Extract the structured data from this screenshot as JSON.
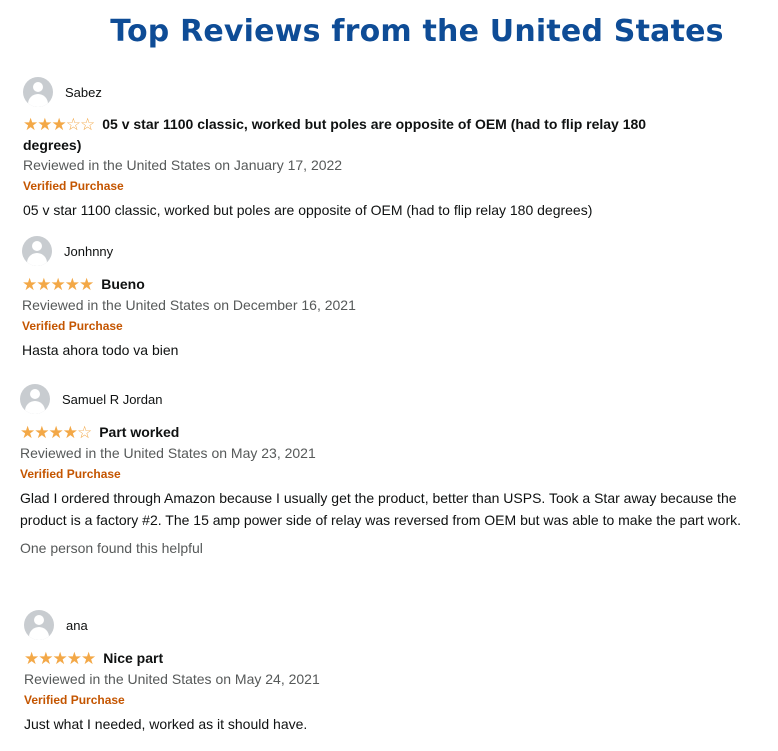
{
  "page": {
    "heading": "Top Reviews from the United States"
  },
  "reviews": [
    {
      "reviewer": "Sabez",
      "rating_stars_filled": 3,
      "rating_stars_total": 5,
      "title": "05 v star 1100 classic, worked but poles are opposite of OEM (had to flip relay 180 degrees)",
      "date": "Reviewed in the United States on January 17, 2022",
      "verified": "Verified Purchase",
      "body": "05 v star 1100 classic, worked but poles are opposite of OEM (had to flip relay 180 degrees)"
    },
    {
      "reviewer": "Jonhnny",
      "rating_stars_filled": 5,
      "rating_stars_total": 5,
      "title": "Bueno",
      "date": "Reviewed in the United States on December 16, 2021",
      "verified": "Verified Purchase",
      "body": "Hasta ahora todo va bien"
    },
    {
      "reviewer": "Samuel R Jordan",
      "rating_stars_filled": 4,
      "rating_stars_total": 5,
      "title": "Part worked",
      "date": "Reviewed in the United States on May 23, 2021",
      "verified": "Verified Purchase",
      "body": "Glad I ordered through Amazon because I usually get the product, better than USPS. Took a Star away because the product is a factory #2. The 15 amp power side of relay was reversed from OEM but was able to make the part work.",
      "helpful": "One person found this helpful"
    },
    {
      "reviewer": "ana",
      "rating_stars_filled": 5,
      "rating_stars_total": 5,
      "title": "Nice part",
      "date": "Reviewed in the United States on May 24, 2021",
      "verified": "Verified Purchase",
      "body": "Just what I needed, worked as it should have."
    }
  ]
}
